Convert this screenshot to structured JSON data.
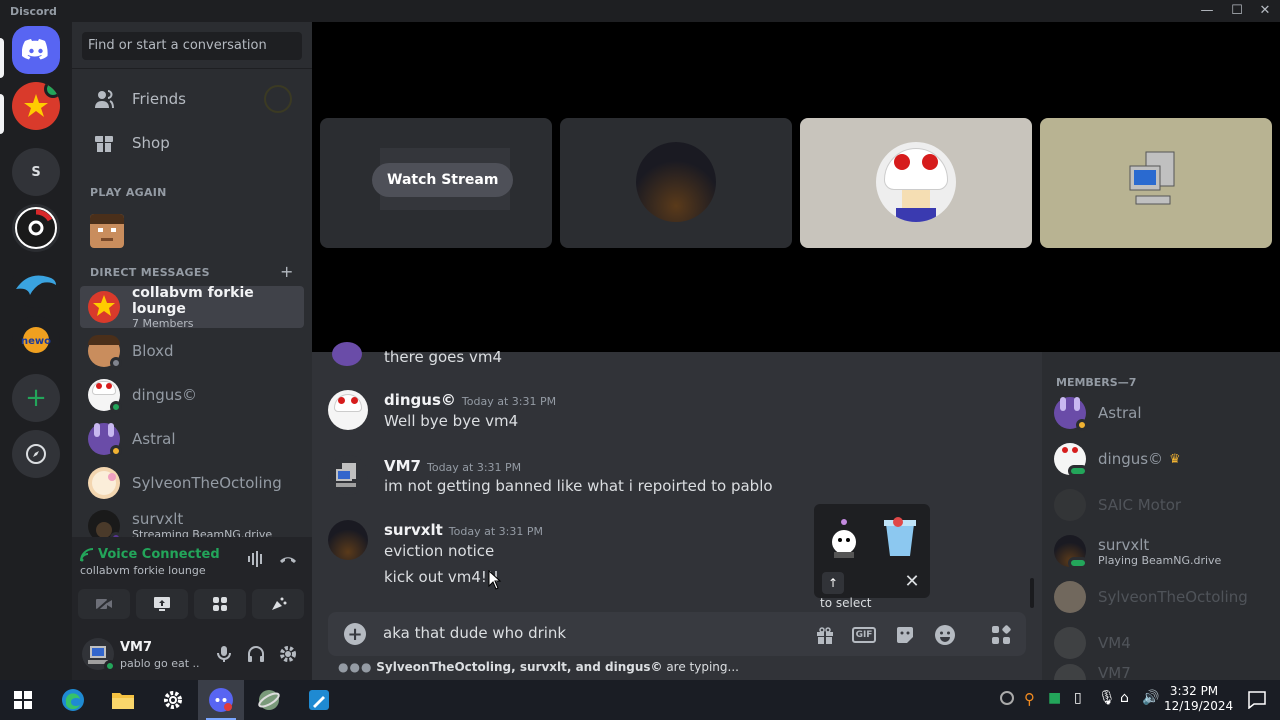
{
  "window": {
    "title": "Discord",
    "minimize": "—",
    "maximize": "☐",
    "close": "✕"
  },
  "guilds": [
    {
      "name": "home",
      "label": ""
    },
    {
      "name": "server-1",
      "label": ""
    },
    {
      "name": "server-s",
      "label": "S"
    },
    {
      "name": "server-obs",
      "label": ""
    },
    {
      "name": "server-dolphin",
      "label": ""
    },
    {
      "name": "server-newo",
      "label": "newo"
    }
  ],
  "search": {
    "placeholder": "Find or start a conversation"
  },
  "nav": {
    "friends": "Friends",
    "shop": "Shop"
  },
  "sections": {
    "play_again": "PLAY AGAIN",
    "direct_messages": "DIRECT MESSAGES",
    "add": "+"
  },
  "dms": [
    {
      "name": "collabvm forkie lounge",
      "sub": "7 Members"
    },
    {
      "name": "Bloxd",
      "sub": ""
    },
    {
      "name": "dingus©",
      "sub": ""
    },
    {
      "name": "Astral",
      "sub": ""
    },
    {
      "name": "SylveonTheOctoling",
      "sub": ""
    },
    {
      "name": "survxlt",
      "sub": "Streaming BeamNG.drive"
    }
  ],
  "voice": {
    "status": "Voice Connected",
    "channel": "collabvm forkie lounge"
  },
  "user": {
    "name": "VM7",
    "status": "pablo go eat ..."
  },
  "stream": {
    "watch_label": "Watch Stream"
  },
  "messages": [
    {
      "author": "",
      "time": "",
      "lines": [
        "there goes vm4"
      ]
    },
    {
      "author": "dingus©",
      "time": "Today at 3:31 PM",
      "lines": [
        "Well bye bye vm4"
      ]
    },
    {
      "author": "VM7",
      "time": "Today at 3:31 PM",
      "lines": [
        "im not getting banned like what i repoirted to pablo"
      ]
    },
    {
      "author": "survxlt",
      "time": "Today at 3:31 PM",
      "lines": [
        "eviction notice",
        "kick out vm4!!!"
      ]
    }
  ],
  "composer": {
    "value": "aka that dude who drink",
    "gif": "GIF"
  },
  "typing": {
    "names": "SylveonTheOctoling, survxlt, and dingus©",
    "suffix": " are typing..."
  },
  "popup": {
    "hint": "to select"
  },
  "members": {
    "header": "MEMBERS—7",
    "list": [
      {
        "name": "Astral",
        "sub": ""
      },
      {
        "name": "dingus©",
        "sub": ""
      },
      {
        "name": "SAIC Motor",
        "sub": ""
      },
      {
        "name": "survxlt",
        "sub": "Playing BeamNG.drive"
      },
      {
        "name": "SylveonTheOctoling",
        "sub": ""
      },
      {
        "name": "VM4",
        "sub": ""
      },
      {
        "name": "VM7",
        "sub": ""
      }
    ]
  },
  "taskbar": {
    "time": "3:32 PM",
    "date": "12/19/2024"
  },
  "colors": {
    "blurple": "#5865f2",
    "online": "#23a55a",
    "voice": "#23a55a"
  }
}
